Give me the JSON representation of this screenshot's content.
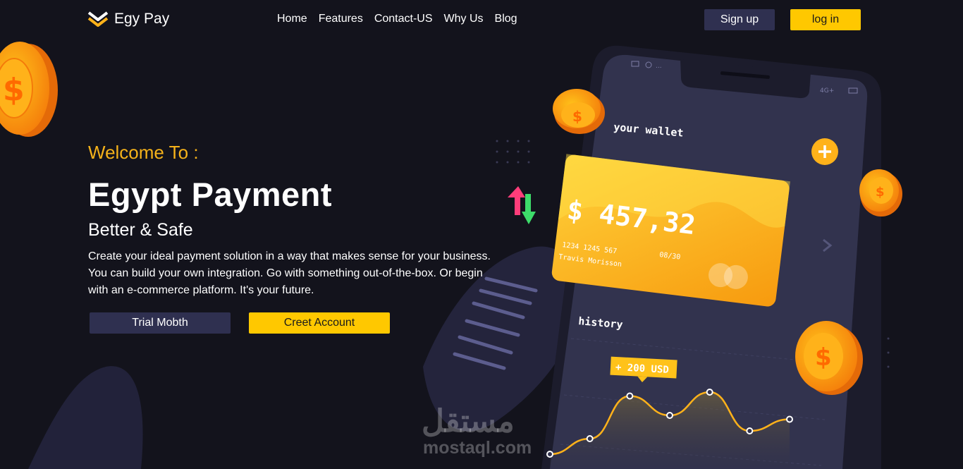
{
  "brand": {
    "name": "Egy Pay",
    "accent": "#ffc800",
    "background": "#13131c",
    "button_dark": "#2f3050"
  },
  "nav": {
    "items": [
      "Home",
      "Features",
      "Contact-US",
      "Why Us",
      "Blog"
    ]
  },
  "auth": {
    "signup_label": "Sign up",
    "login_label": "log in"
  },
  "hero": {
    "welcome": "Welcome To :",
    "title": "Egypt Payment",
    "subtitle": "Better & Safe",
    "description": "Create your ideal payment solution in a way that makes sense for your business. You can build your own integration. Go with something out-of-the-box. Or begin with an e-commerce platform. It's your future.",
    "trial_label": "Trial Mobth",
    "create_label": "Creet Account"
  },
  "phone": {
    "status": "4G+",
    "wallet_label": "your wallet",
    "card": {
      "balance": "$ 457,32",
      "number": "1234 1245 567",
      "expiry": "08/30",
      "holder": "Travis Morisson"
    },
    "history_label": "history",
    "tooltip": "+ 200 USD",
    "chart_points": [
      0.1,
      0.3,
      0.85,
      0.6,
      0.9,
      0.4,
      0.55
    ]
  },
  "watermark": {
    "arabic": "مستقل",
    "latin": "mostaql.com"
  }
}
